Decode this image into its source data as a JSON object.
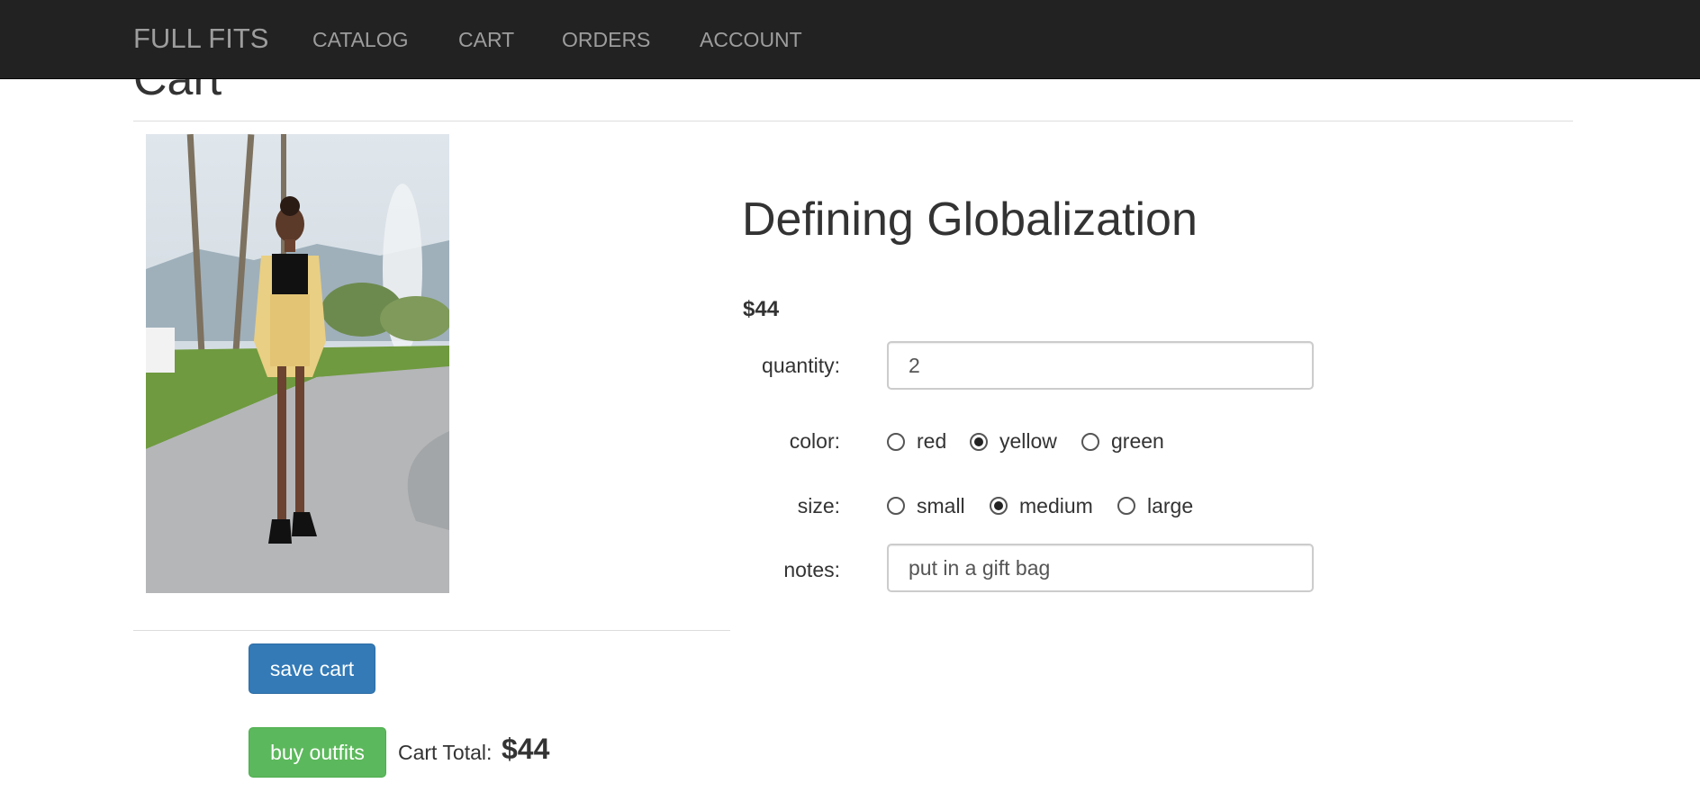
{
  "navbar": {
    "brand": "FULL FITS",
    "links": [
      "CATALOG",
      "CART",
      "ORDERS",
      "ACCOUNT"
    ]
  },
  "page": {
    "title": "Cart"
  },
  "item": {
    "name": "Defining Globalization",
    "price": "$44",
    "quantity": {
      "label": "quantity:",
      "value": "2"
    },
    "color": {
      "label": "color:",
      "options": [
        "red",
        "yellow",
        "green"
      ],
      "selected": "yellow"
    },
    "size": {
      "label": "size:",
      "options": [
        "small",
        "medium",
        "large"
      ],
      "selected": "medium"
    },
    "notes": {
      "label": "notes:",
      "value": "put in a gift bag"
    }
  },
  "actions": {
    "save_label": "save cart",
    "buy_label": "buy outfits"
  },
  "cart_total": {
    "label": "Cart Total:",
    "value": "$44"
  },
  "colors": {
    "navbar_bg": "#222222",
    "nav_text": "#9d9d9d",
    "save_button": "#337ab7",
    "buy_button": "#5cb85c"
  }
}
